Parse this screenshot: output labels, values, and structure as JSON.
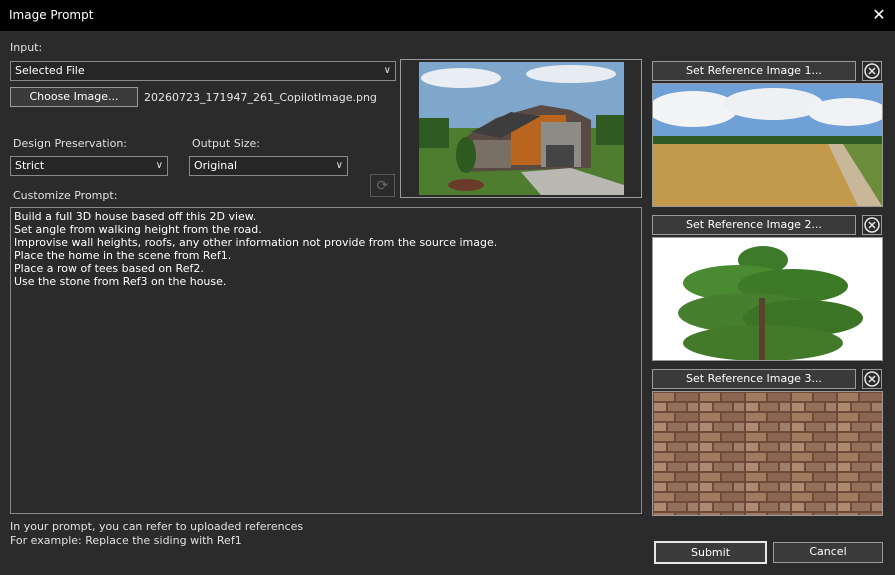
{
  "window": {
    "title": "Image Prompt",
    "close_icon": "close-icon"
  },
  "input": {
    "label": "Input:",
    "selected_value": "Selected File",
    "choose_button": "Choose Image...",
    "file_name": "20260723_171947_261_CopilotImage.png"
  },
  "design_preservation": {
    "label": "Design Preservation:",
    "selected_value": "Strict"
  },
  "output_size": {
    "label": "Output Size:",
    "selected_value": "Original"
  },
  "prompt": {
    "label": "Customize Prompt:",
    "text": "Build a full 3D house based off this 2D view.\nSet angle from walking height from the road.\nImprovise wall heights, roofs, any other information not provide from the source image.\nPlace the home in the scene from Ref1.\nPlace a row of tees based on Ref2.\nUse the stone from Ref3 on the house."
  },
  "references": [
    {
      "button": "Set Reference Image 1..."
    },
    {
      "button": "Set Reference Image 2..."
    },
    {
      "button": "Set Reference Image 3..."
    }
  ],
  "hint": {
    "line1": "In your prompt, you can refer to uploaded references",
    "line2": "For example: Replace the siding with Ref1"
  },
  "actions": {
    "submit": "Submit",
    "cancel": "Cancel"
  }
}
